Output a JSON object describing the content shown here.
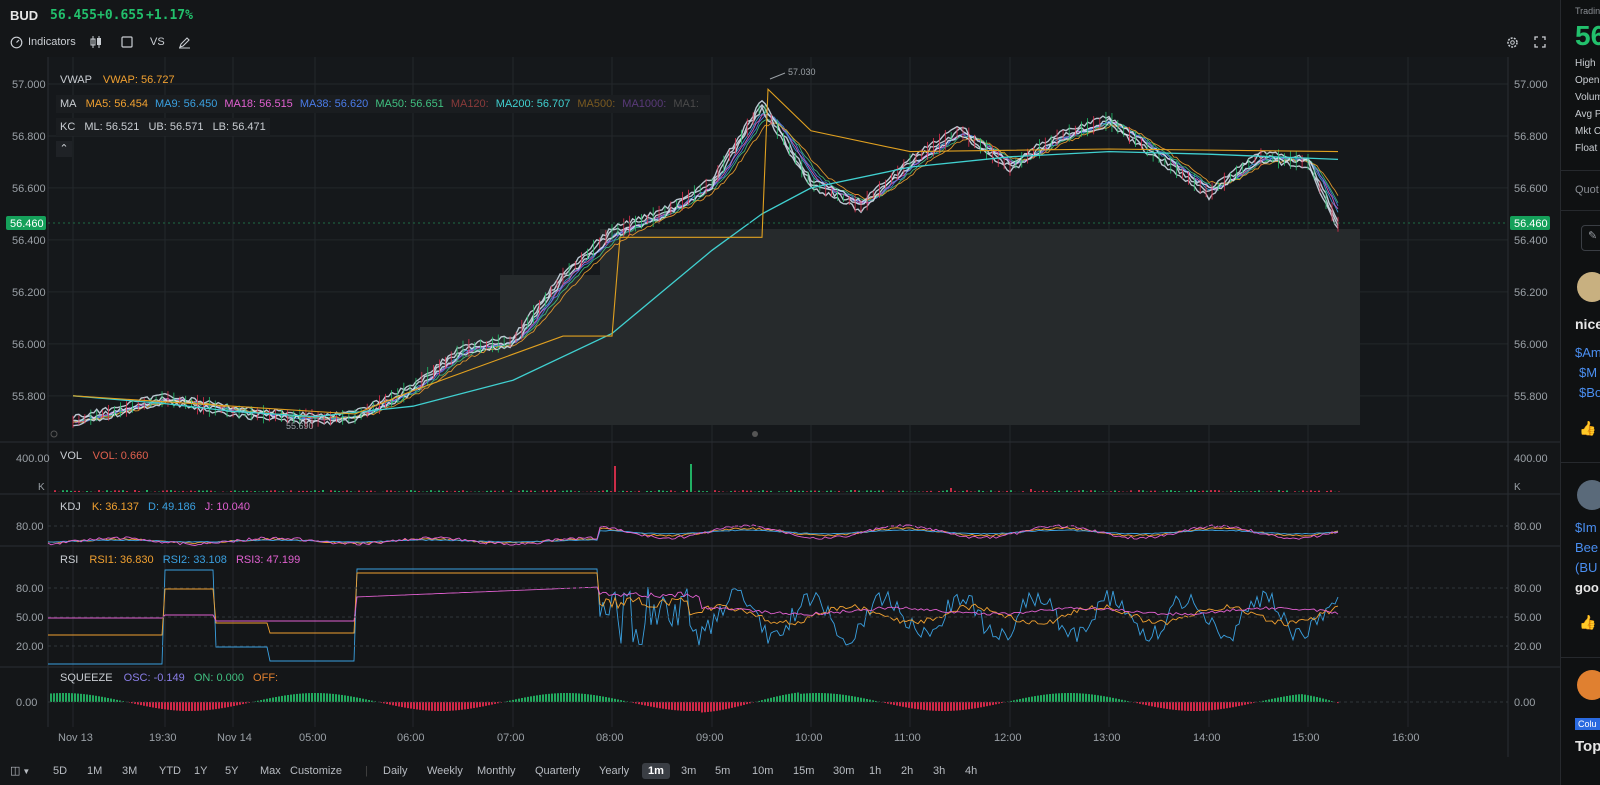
{
  "header": {
    "symbol": "BUD",
    "price": "56.455",
    "change": "+0.655",
    "change_pct": "+1.17%",
    "up_color": "#22c06c",
    "down_color": "#e0304e"
  },
  "toolbar": {
    "indicators_label": "Indicators",
    "vs_label": "VS"
  },
  "overlays": {
    "vwap": {
      "name": "VWAP",
      "text": "VWAP: 56.727"
    },
    "ma": {
      "name": "MA",
      "items": [
        {
          "text": "MA5: 56.454",
          "color": "#f0a030"
        },
        {
          "text": "MA9: 56.450",
          "color": "#3aa0e0"
        },
        {
          "text": "MA18: 56.515",
          "color": "#e060d0"
        },
        {
          "text": "MA38: 56.620",
          "color": "#4a7be8"
        },
        {
          "text": "MA50: 56.651",
          "color": "#40c080"
        },
        {
          "text": "MA120:",
          "color": "#8a3a3a"
        },
        {
          "text": "MA200: 56.707",
          "color": "#40d0d0"
        },
        {
          "text": "MA500:",
          "color": "#7a5a20"
        },
        {
          "text": "MA1000:",
          "color": "#5a3a7a"
        },
        {
          "text": "MA1:",
          "color": "#4a4a4a"
        }
      ]
    },
    "kc": {
      "name": "KC",
      "ml": "ML: 56.521",
      "ub": "UB: 56.571",
      "lb": "LB: 56.471"
    },
    "collapse_icon": "chevron-up-icon"
  },
  "main_axis": {
    "ticks": [
      "57.000",
      "56.800",
      "56.600",
      "56.400",
      "56.200",
      "56.000",
      "55.800"
    ],
    "current_price_tag": "56.460",
    "high_marker": "57.030",
    "low_marker": "55.690"
  },
  "vol_panel": {
    "name": "VOL",
    "value": "VOL: 0.660",
    "tick": "400.00",
    "unit": "K"
  },
  "kdj_panel": {
    "name": "KDJ",
    "k": "K: 36.137",
    "d": "D: 49.186",
    "j": "J: 10.040",
    "tick": "80.00"
  },
  "rsi_panel": {
    "name": "RSI",
    "rsi1": "RSI1: 36.830",
    "rsi2": "RSI2: 33.108",
    "rsi3": "RSI3: 47.199",
    "ticks": [
      "80.00",
      "50.00",
      "20.00"
    ]
  },
  "squeeze_panel": {
    "name": "SQUEEZE",
    "osc": "OSC: -0.149",
    "on": "ON: 0.000",
    "off": "OFF:",
    "tick": "0.00"
  },
  "time_axis": [
    "Nov 13",
    "19:30",
    "Nov 14",
    "05:00",
    "06:00",
    "07:00",
    "08:00",
    "09:00",
    "10:00",
    "11:00",
    "12:00",
    "13:00",
    "14:00",
    "15:00",
    "16:00"
  ],
  "chart_data": {
    "type": "line",
    "title": "BUD",
    "x_labels": [
      "Nov 13",
      "19:30",
      "Nov 14",
      "05:00",
      "06:00",
      "07:00",
      "08:00",
      "09:00",
      "10:00",
      "11:00",
      "12:00",
      "13:00",
      "14:00",
      "15:00",
      "16:00"
    ],
    "ylim": [
      55.68,
      57.05
    ],
    "price_path": [
      [
        "Nov 13",
        55.7
      ],
      [
        "19:30",
        55.79
      ],
      [
        "Nov 14",
        55.74
      ],
      [
        "05:00",
        55.71
      ],
      [
        "05:30",
        55.72
      ],
      [
        "06:00",
        55.83
      ],
      [
        "06:30",
        55.98
      ],
      [
        "07:00",
        56.01
      ],
      [
        "07:30",
        56.26
      ],
      [
        "08:00",
        56.43
      ],
      [
        "08:30",
        56.5
      ],
      [
        "09:00",
        56.62
      ],
      [
        "09:30",
        56.92
      ],
      [
        "10:00",
        56.62
      ],
      [
        "10:30",
        56.53
      ],
      [
        "11:00",
        56.7
      ],
      [
        "11:30",
        56.82
      ],
      [
        "12:00",
        56.68
      ],
      [
        "12:30",
        56.8
      ],
      [
        "13:00",
        56.86
      ],
      [
        "13:30",
        56.72
      ],
      [
        "14:00",
        56.58
      ],
      [
        "14:30",
        56.72
      ],
      [
        "15:00",
        56.7
      ],
      [
        "15:15",
        56.46
      ]
    ],
    "ma200_path": [
      [
        "Nov 13",
        55.8
      ],
      [
        "19:30",
        55.77
      ],
      [
        "Nov 14",
        55.74
      ],
      [
        "05:00",
        55.72
      ],
      [
        "06:00",
        55.76
      ],
      [
        "07:00",
        55.86
      ],
      [
        "08:00",
        56.04
      ],
      [
        "08:30",
        56.2
      ],
      [
        "09:00",
        56.36
      ],
      [
        "09:30",
        56.5
      ],
      [
        "10:00",
        56.6
      ],
      [
        "11:00",
        56.68
      ],
      [
        "12:00",
        56.72
      ],
      [
        "13:00",
        56.74
      ],
      [
        "14:00",
        56.73
      ],
      [
        "15:15",
        56.71
      ]
    ],
    "vwap_path": [
      [
        "Nov 13",
        55.8
      ],
      [
        "Nov 14",
        55.76
      ],
      [
        "05:30",
        55.73
      ],
      [
        "06:00",
        55.82
      ],
      [
        "07:00",
        55.96
      ],
      [
        "07:30",
        56.03
      ],
      [
        "08:00",
        56.03
      ],
      [
        "08:05",
        56.41
      ],
      [
        "09:30",
        56.41
      ],
      [
        "09:35",
        56.98
      ],
      [
        "10:00",
        56.82
      ],
      [
        "11:00",
        56.74
      ],
      [
        "13:00",
        56.75
      ],
      [
        "15:15",
        56.74
      ]
    ]
  },
  "bottom_bar": {
    "ranges": [
      "5D",
      "1M",
      "3M",
      "YTD",
      "1Y",
      "5Y",
      "Max",
      "Customize"
    ],
    "periods": [
      "Daily",
      "Weekly",
      "Monthly",
      "Quarterly",
      "Yearly"
    ],
    "intervals": [
      "1m",
      "3m",
      "5m",
      "10m",
      "15m",
      "30m",
      "1h",
      "2h",
      "3h",
      "4h"
    ],
    "active_interval": "1m"
  },
  "right_panel": {
    "tab_label": "Tradin",
    "big_price": "56",
    "stats": [
      "High",
      "Open",
      "Volum",
      "Avg P",
      "Mkt C",
      "Float"
    ],
    "quote_tab": "Quot",
    "post1_user": "nice",
    "post1_lines": [
      "$Am",
      "$M",
      "$Bo"
    ],
    "post2_lines": [
      "$Im",
      "Bee",
      "(BU",
      "goo"
    ],
    "tag_label": "Colu",
    "post3_title": "Top"
  }
}
